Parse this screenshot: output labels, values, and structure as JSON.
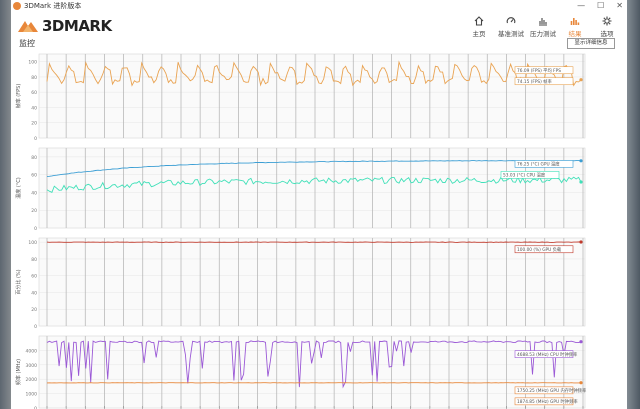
{
  "window": {
    "title": "3DMark 进阶版本",
    "minimize": "—",
    "maximize": "☐",
    "close": "✕"
  },
  "brand": {
    "name": "3DMARK"
  },
  "nav": [
    {
      "label": "主页",
      "icon": "home-icon"
    },
    {
      "label": "基准测试",
      "icon": "gauge-icon"
    },
    {
      "label": "压力测试",
      "icon": "stress-icon"
    },
    {
      "label": "结果",
      "icon": "bar-chart-icon",
      "active": true
    },
    {
      "label": "选项",
      "icon": "gear-icon"
    }
  ],
  "panel": {
    "title": "监控",
    "env_button": "显示详细信息"
  },
  "colors": {
    "fps": "#e9a352",
    "gpu_temp": "#3b9ed4",
    "cpu_temp": "#3fe0b8",
    "gpu_load": "#c0392b",
    "cpu_clock": "#9b59d6",
    "gpu_clock": "#e8873a",
    "accent": "#e8873a"
  },
  "chart_data": [
    {
      "type": "line",
      "ylabel": "帧率 (FPS)",
      "yticks": [
        0,
        20,
        40,
        60,
        80,
        100
      ],
      "ylim": [
        0,
        110
      ],
      "series": [
        {
          "name": "FPS",
          "pattern": "sawtooth",
          "base": 74,
          "peak": 100
        }
      ],
      "annotations": [
        {
          "text": "76.09 (FPS) 平均 FPS",
          "series": 0
        },
        {
          "text": "74.15 (FPS) 帧率",
          "series": 0
        }
      ]
    },
    {
      "type": "line",
      "ylabel": "温度 (°C)",
      "yticks": [
        0,
        20,
        40,
        60,
        80
      ],
      "ylim": [
        0,
        90
      ],
      "series": [
        {
          "name": "GPU 温度",
          "start": 58,
          "end": 76
        },
        {
          "name": "CPU 温度",
          "start": 43,
          "end": 54
        }
      ],
      "annotations": [
        {
          "text": "76.25 (°C) GPU 温度",
          "series": 0
        },
        {
          "text": "53.03 (°C) CPU 温度",
          "series": 1
        }
      ]
    },
    {
      "type": "line",
      "ylabel": "百分比 (%)",
      "yticks": [
        0,
        20,
        40,
        60,
        80,
        100
      ],
      "ylim": [
        0,
        105
      ],
      "series": [
        {
          "name": "GPU 负载",
          "value": 100
        }
      ],
      "annotations": [
        {
          "text": "100.00 (%) GPU 负载",
          "series": 0
        }
      ]
    },
    {
      "type": "line",
      "ylabel": "频率 (MHz)",
      "yticks": [
        0,
        1000,
        2000,
        3000,
        4000
      ],
      "ylim": [
        0,
        5000
      ],
      "series": [
        {
          "name": "CPU 时钟频率",
          "base": 4600
        },
        {
          "name": "GPU 时钟频率",
          "value": 1750
        }
      ],
      "annotations": [
        {
          "text": "4688.53 (MHz) CPU 时钟频率",
          "series": 0
        },
        {
          "text": "1750.25 (MHz) GPU 内存时钟频率",
          "series": 1
        },
        {
          "text": "1874.85 (MHz) GPU 时钟频率",
          "series": 1
        }
      ]
    }
  ]
}
